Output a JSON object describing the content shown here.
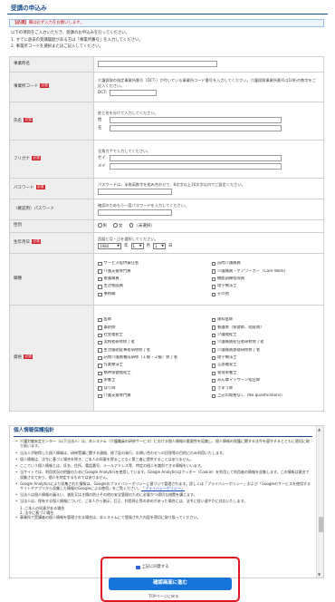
{
  "page_title": "受講の申込み",
  "notice": {
    "required_tag": "【必須】",
    "text": "欄は必ず入力をお願いします。"
  },
  "intro": [
    "以下の項目をご入力いただき、受講のお申込みを行ってください。",
    "1. すでに過去の受講履歴がある方は「事業所番号」を入力してください。",
    "2. 事業所コードを選択またはご記入してください。"
  ],
  "required_badge": "必須",
  "fields": {
    "office_name": {
      "label": "事業所名"
    },
    "office_code": {
      "label": "事業所コード",
      "note": "介護保険の指定事業所番号（DCT-）が付いている事業所コード番号を入力してください。介護保険事業所番号は10桁の数字をご記入ください。",
      "prefix": "DCT-"
    },
    "name": {
      "label": "氏名",
      "note": "姓と名を分けて入力してください。",
      "sei_label": "姓",
      "mei_label": "名"
    },
    "furigana": {
      "label": "フリガナ",
      "note": "全角カナで入力してください。",
      "sei_label": "セイ",
      "mei_label": "メイ"
    },
    "password": {
      "label": "パスワード",
      "note": "パスワードは、半角英数字を組み合わせて、8文字以上16文字以内でご設定ください。"
    },
    "password_confirm": {
      "label": "（確認用）パスワード",
      "note": "確認のためもう一度パスワードを入力してください。"
    },
    "gender": {
      "label": "性別",
      "options": [
        "男",
        "女",
        "（未選択）"
      ]
    },
    "birthdate": {
      "label": "生年月日",
      "note": "西暦と月・日を選択してください。",
      "year_value": "1980",
      "month_value": "1",
      "day_value": "1",
      "year_suffix": "年",
      "month_suffix": "月",
      "day_suffix": "日"
    },
    "job": {
      "label": "職種",
      "options": [
        "サービス提供責任者",
        "訪問介護職員",
        "介護支援専門員",
        "介護職員・ケアワーカー（Care Work）",
        "看護職員",
        "機能訓練指導員",
        "生活相談員",
        "理学療法士",
        "事務職",
        "その他"
      ]
    },
    "qualification": {
      "label": "資格",
      "options": [
        "医師",
        "歯科医師",
        "薬剤師",
        "看護師（保健師、助産師）",
        "社会福祉士",
        "介護福祉士",
        "実務者研修修了者",
        "介護職員初任者研修修了者",
        "生活援助従事者研修修了者",
        "介護職員基礎研修修了者",
        "訪問介護員養成研修（１級・２級）修了者",
        "理学療法士",
        "作業療法士",
        "言語聴覚士",
        "精神保健福祉士",
        "管理栄養士",
        "栄養士",
        "あん摩マッサージ指圧師",
        "はり師",
        "きゅう師",
        "介護支援専門員",
        "上記の資格なし（No qualifications）"
      ]
    }
  },
  "privacy": {
    "title": "個人情報保護指針",
    "items": [
      "介護労働安定センター（以下当法人）は、本システム（介護職員の研修サービス）における個人情報の重要性を認識し、個人情報の保護に関する法令を遵守するとともに適切に取り扱います。",
      "当法人が取得した個人情報は、研修受講に関する連絡、修了証の発行、お問い合わせへの回答等の目的にのみ利用いたします。",
      "個人情報は、法令に基づく場合を除き、ご本人の同意を得ることなく第三者に提供することはありません。",
      "ここでいう個人情報とは、氏名、住所、電話番号、メールアドレス等、特定の個人を識別できる情報をいいます。",
      "当サイトでは、利用状況の把握のためにGoogle Analyticsを使用しています。Google Analyticsはクッキー（Cookie）を利用して利用者の情報を収集します。この情報は匿名で収集されており、個人を特定するものではありません。",
      "Google Analyticsにより収集された情報は、Googleのプライバシーポリシーに基づいて管理されます。詳しくは「プライバシーポリシー」および「Googleのサービスを使用するサイトやアプリから収集した情報のGoogleによる使用」をご覧ください。",
      "当法人は個人情報の漏えい、滅失又はき損の防止その他の安全管理のために必要かつ適切な措置を講じます。",
      "当法人は、保有する個人情報について、ご本人から開示、訂正、利用停止等の求めがあった場合には、法令に従い速やかに対応いたします。"
    ],
    "sub_items": [
      "1. ご本人の同意がある場合",
      "2. 法令に基づく場合"
    ],
    "last_item": "事業所で受講者の個人情報を管理される場合は、本システムにて登録された内容を適切に取り扱ってください。",
    "link_text": "「プライバシーポリシー」"
  },
  "agree": {
    "label": "上記に同意する",
    "checked": true
  },
  "confirm_button": "確認画面に進む",
  "back_link": "TOPページに戻る",
  "colors": {
    "accent": "#1b4f8c",
    "required": "#d2262e",
    "button": "#1673d8",
    "highlight_frame": "#e0161e"
  }
}
